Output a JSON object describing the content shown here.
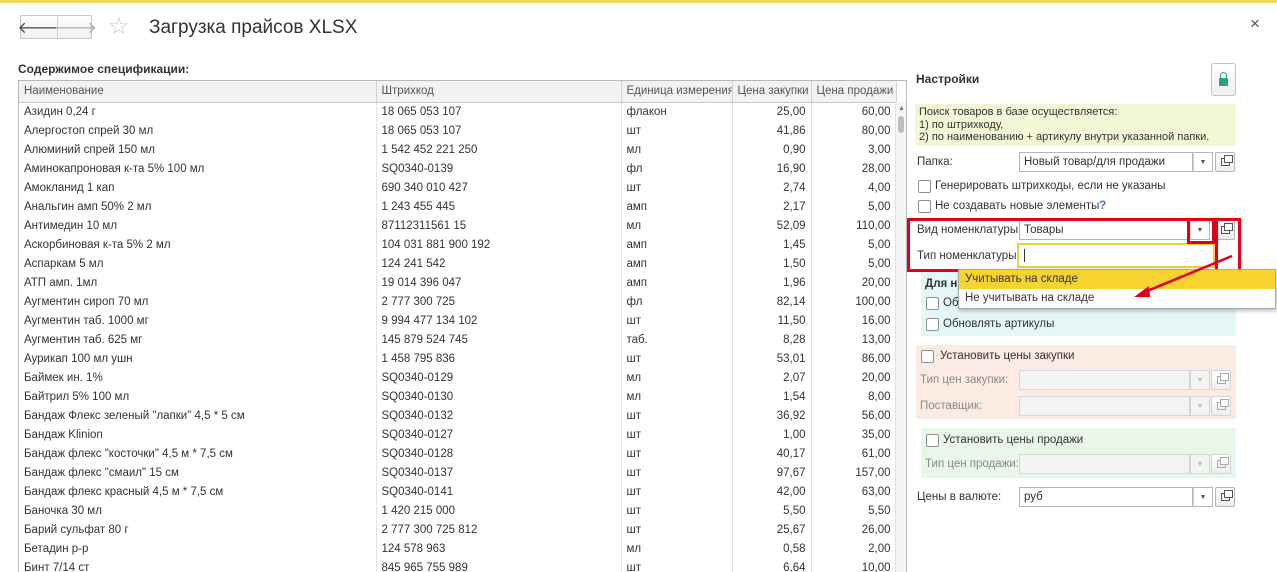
{
  "window": {
    "title": "Загрузка прайсов XLSX",
    "back_icon": "arrow-left-icon",
    "forward_icon": "arrow-right-icon",
    "close_glyph": "×"
  },
  "spec": {
    "title": "Содержимое спецификации:",
    "columns": [
      "Наименование",
      "Штрихкод",
      "Единица измерения",
      "Цена закупки",
      "Цена продажи"
    ],
    "rows": [
      [
        "Азидин 0,24 г",
        "18 065 053 107",
        "флакон",
        "25,00",
        "60,00"
      ],
      [
        "Алергостоп спрей 30 мл",
        "18 065 053 107",
        "шт",
        "41,86",
        "80,00"
      ],
      [
        "Алюминий спрей 150 мл",
        "1 542 452 221 250",
        "мл",
        "0,90",
        "3,00"
      ],
      [
        "Аминокапроновая к-та 5%  100 мл",
        "SQ0340-0139",
        "фл",
        "16,90",
        "28,00"
      ],
      [
        "Амокланид 1 кап",
        "690 340 010 427",
        "шт",
        "2,74",
        "4,00"
      ],
      [
        "Анальгин амп 50% 2 мл",
        "1 243 455 445",
        "амп",
        "2,17",
        "5,00"
      ],
      [
        "Антимедин 10 мл",
        "87112311561 15",
        "мл",
        "52,09",
        "110,00"
      ],
      [
        "Аскорбиновая к-та 5% 2 мл",
        "104 031 881 900 192",
        "амп",
        "1,45",
        "5,00"
      ],
      [
        "Аспаркам 5 мл",
        "124 241 542",
        "амп",
        "1,50",
        "5,00"
      ],
      [
        "АТП амп. 1мл",
        "19 014 396 047",
        "амп",
        "1,96",
        "20,00"
      ],
      [
        "Аугментин сироп 70 мл",
        "2 777 300 725",
        "фл",
        "82,14",
        "100,00"
      ],
      [
        "Аугментин таб. 1000 мг",
        "9 994 477 134 102",
        "шт",
        "11,50",
        "16,00"
      ],
      [
        "Аугментин таб. 625 мг",
        "145 879 524 745",
        "таб.",
        "8,28",
        "13,00"
      ],
      [
        "Аурикап 100 мл ушн",
        "1 458 795 836",
        "шт",
        "53,01",
        "86,00"
      ],
      [
        "Баймек ин. 1%",
        "SQ0340-0129",
        "мл",
        "2,07",
        "20,00"
      ],
      [
        "Байтрил 5% 100 мл",
        "SQ0340-0130",
        "мл",
        "1,54",
        "8,00"
      ],
      [
        "Бандаж  Флекс зеленый  \"лапки\" 4,5 * 5 см",
        "SQ0340-0132",
        "шт",
        "36,92",
        "56,00"
      ],
      [
        "Бандаж Klinion",
        "SQ0340-0127",
        "шт",
        "1,00",
        "35,00"
      ],
      [
        "Бандаж флекс \"косточки\"  4,5 м * 7,5 см",
        "SQ0340-0128",
        "шт",
        "40,17",
        "61,00"
      ],
      [
        "Бандаж флекс \"смаил\" 15 см",
        "SQ0340-0137",
        "шт",
        "97,67",
        "157,00"
      ],
      [
        "Бандаж флекс красный 4,5 м * 7,5 см",
        "SQ0340-0141",
        "шт",
        "42,00",
        "63,00"
      ],
      [
        "Баночка 30 мл",
        "1 420 215 000",
        "шт",
        "5,50",
        "5,50"
      ],
      [
        "Барий сульфат 80 г",
        "2 777 300 725 812",
        "шт",
        "25,67",
        "26,00"
      ],
      [
        "Бетадин р-р",
        "124 578 963",
        "мл",
        "0,58",
        "2,00"
      ],
      [
        "Бинт 7/14 ст",
        "845 965 755 989",
        "шт",
        "6,64",
        "10,00"
      ]
    ]
  },
  "settings": {
    "title": "Настройки",
    "lock_icon": "lock-icon",
    "info_lines": [
      "Поиск товаров в базе осуществляется:",
      "1) по штрихкоду,",
      "2) по наименованию + артикулу внутри указанной папки."
    ],
    "folder_label": "Папка:",
    "folder_value": "Новый товар/для продажи",
    "gen_barcodes_label": "Генерировать штрихкоды, если не указаны",
    "no_new_items_label": "Не создавать новые элементы",
    "help_glyph": "?",
    "kind_label": "Вид номенклатуры:",
    "kind_value": "Товары",
    "type_label": "Тип номенклатуры:",
    "type_value": "",
    "group_cut_title": "Для н",
    "group_cut_check": "Об",
    "update_articles_label": "Обновлять артикулы",
    "set_purchase_prices_label": "Установить цены закупки",
    "purchase_price_type_label": "Тип цен закупки:",
    "supplier_label": "Поставщик:",
    "set_sale_prices_label": "Установить цены продажи",
    "sale_price_type_label": "Тип цен продажи:",
    "currency_label": "Цены в валюте:",
    "currency_value": "руб"
  },
  "popup": {
    "options": [
      "Учитывать на складе",
      "Не учитывать на складе"
    ],
    "selected_index": 0
  },
  "colors": {
    "highlight": "#e0001a",
    "selection": "#f8d22f",
    "info_bg": "#f0f8d6"
  }
}
